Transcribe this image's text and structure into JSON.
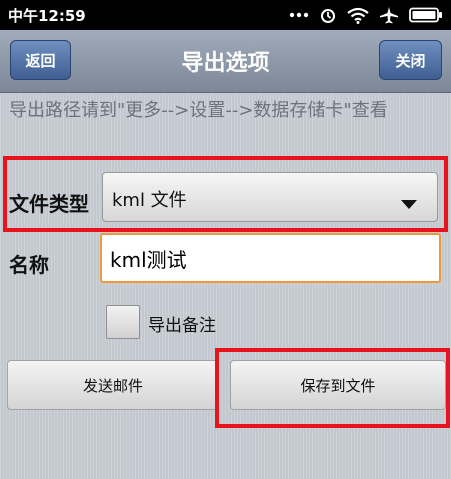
{
  "status_bar": {
    "time": "中午12:59",
    "icons": [
      "dots-icon",
      "alarm-icon",
      "wifi-icon",
      "airplane-icon",
      "battery-icon"
    ]
  },
  "header": {
    "title": "导出选项",
    "back_label": "返回",
    "close_label": "关闭"
  },
  "hint": "导出路径请到\"更多-->设置-->数据存储卡\"查看",
  "form": {
    "file_type_label": "文件类型",
    "file_type_value": "kml 文件",
    "name_label": "名称",
    "name_value": "kml测试",
    "export_notes_label": "导出备注",
    "export_notes_checked": false
  },
  "actions": {
    "send_email_label": "发送邮件",
    "save_to_file_label": "保存到文件"
  },
  "colors": {
    "highlight": "#e8131c",
    "nav_button": "#4f6fa3",
    "input_focus": "#ef9a3a"
  }
}
